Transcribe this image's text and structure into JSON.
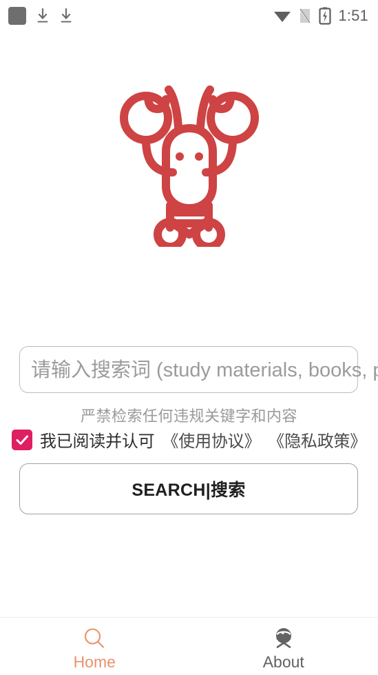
{
  "status_bar": {
    "time": "1:51",
    "left_icons": [
      "app-square-icon",
      "download-icon",
      "download-icon"
    ],
    "right_icons": [
      "wifi-icon",
      "no-sim-icon",
      "battery-charging-icon"
    ],
    "icon_color": "#6e6e6e"
  },
  "brand": {
    "logo_name": "lobster-logo",
    "logo_color": "#CE4343"
  },
  "search": {
    "value": "",
    "placeholder": "请输入搜索词 (study materials, books, papers)",
    "button_label": "SEARCH|搜索"
  },
  "notice": {
    "warning_text": "严禁检索任何违规关键字和内容",
    "warning_color": "#9a9a9a"
  },
  "agreement": {
    "checked": true,
    "checkbox_color": "#DE1F62",
    "label": "我已阅读并认可",
    "terms_link": "《使用协议》",
    "privacy_link": "《隐私政策》"
  },
  "bottom_nav": {
    "active_color": "#E8926B",
    "inactive_color": "#616161",
    "items": [
      {
        "id": "home",
        "label": "Home",
        "icon": "search-icon",
        "active": true
      },
      {
        "id": "about",
        "label": "About",
        "icon": "crab-icon",
        "active": false
      }
    ]
  }
}
